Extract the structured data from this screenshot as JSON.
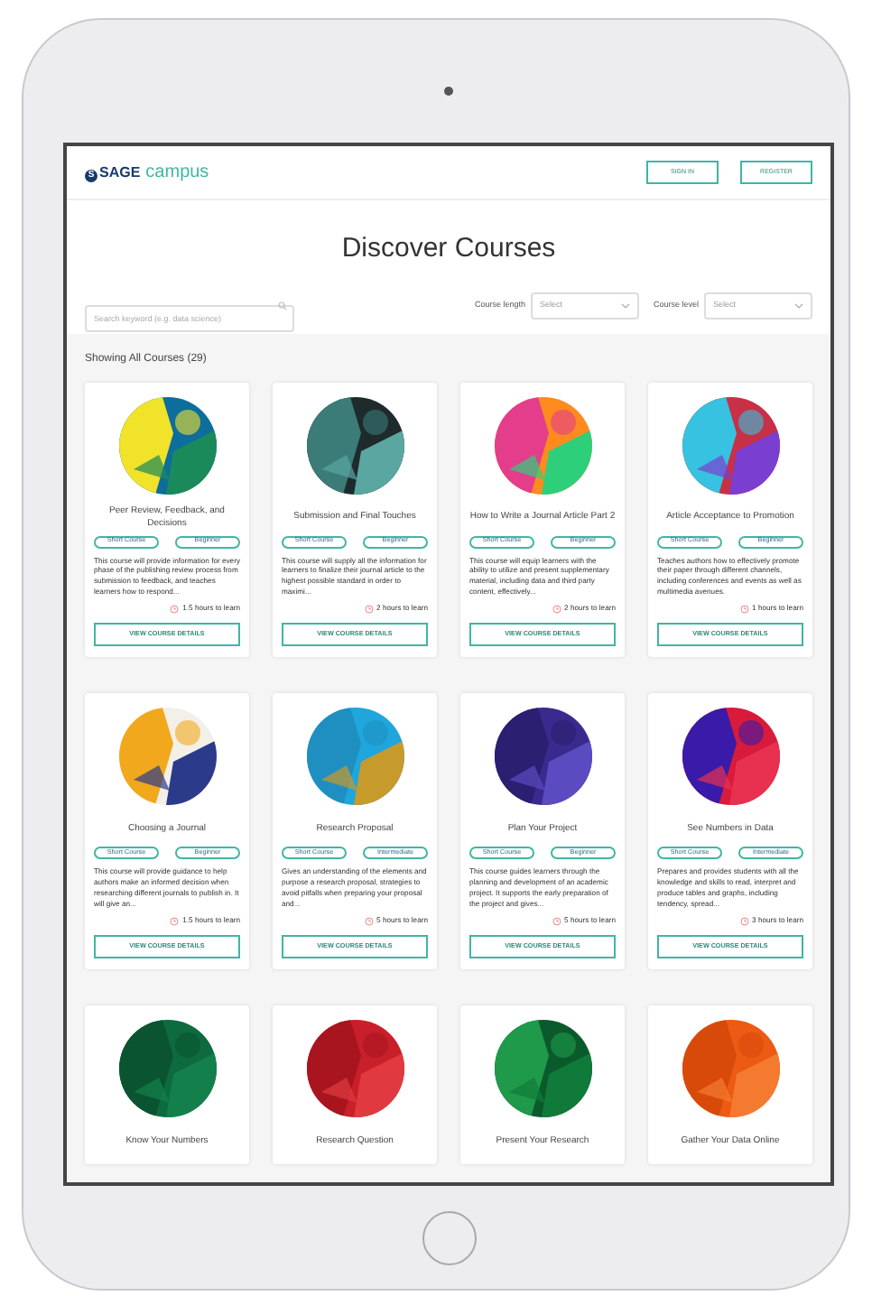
{
  "header": {
    "logo_mark": "S",
    "logo_brand": "SAGE",
    "logo_product": "campus",
    "buttons": [
      "SIGN IN",
      "REGISTER"
    ]
  },
  "page_title": "Discover Courses",
  "search": {
    "placeholder": "Search keyword (e.g. data science)"
  },
  "filters": [
    {
      "label": "Course length",
      "value": "Select"
    },
    {
      "label": "Course level",
      "value": "Select"
    }
  ],
  "results_label": "Showing All Courses (29)",
  "courses": [
    {
      "title": "Peer Review, Feedback, and Decisions",
      "tags": [
        "Short Course",
        "Beginner"
      ],
      "description": "This course will provide information for every phase of the publishing review process from submission to feedback, and teaches learners how to respond...",
      "duration": "1.5 hours to learn",
      "button": "VIEW COURSE DETAILS"
    },
    {
      "title": "Submission and Final Touches",
      "tags": [
        "Short Course",
        "Beginner"
      ],
      "description": "This course will supply all the information for learners to finalize their journal article to the highest possible standard in order to maximi...",
      "duration": "2 hours to learn",
      "button": "VIEW COURSE DETAILS"
    },
    {
      "title": "How to Write a Journal Article Part 2",
      "tags": [
        "Short Course",
        "Beginner"
      ],
      "description": "This course will equip learners with the ability to utilize and present supplementary material, including data and third party content, effectively...",
      "duration": "2 hours to learn",
      "button": "VIEW COURSE DETAILS"
    },
    {
      "title": "Article Acceptance to Promotion",
      "tags": [
        "Short Course",
        "Beginner"
      ],
      "description": "Teaches authors how to effectively promote their paper through different channels, including conferences and events as well as multimedia avenues.",
      "duration": "1 hours to learn",
      "button": "VIEW COURSE DETAILS"
    },
    {
      "title": "Choosing a Journal",
      "tags": [
        "Short Course",
        "Beginner"
      ],
      "description": "This course will provide guidance to help authors make an informed decision when researching different journals to publish in. It will give an...",
      "duration": "1.5 hours to learn",
      "button": "VIEW COURSE DETAILS"
    },
    {
      "title": "Research Proposal",
      "tags": [
        "Short Course",
        "Intermediate"
      ],
      "description": "Gives an understanding of the elements and purpose a research proposal, strategies to avoid pitfalls when preparing your proposal and...",
      "duration": "5 hours to learn",
      "button": "VIEW COURSE DETAILS"
    },
    {
      "title": "Plan Your Project",
      "tags": [
        "Short Course",
        "Beginner"
      ],
      "description": "This course guides learners through the planning and development of an academic project. It supports the early preparation of the project and gives...",
      "duration": "5 hours to learn",
      "button": "VIEW COURSE DETAILS"
    },
    {
      "title": "See Numbers in Data",
      "tags": [
        "Short Course",
        "Intermediate"
      ],
      "description": "Prepares and provides students with all the knowledge and skills to read, interpret and produce tables and graphs, including tendency, spread...",
      "duration": "3 hours to learn",
      "button": "VIEW COURSE DETAILS"
    },
    {
      "title": "Know Your Numbers"
    },
    {
      "title": "Research Question"
    },
    {
      "title": "Present Your Research"
    },
    {
      "title": "Gather Your Data Online"
    }
  ]
}
